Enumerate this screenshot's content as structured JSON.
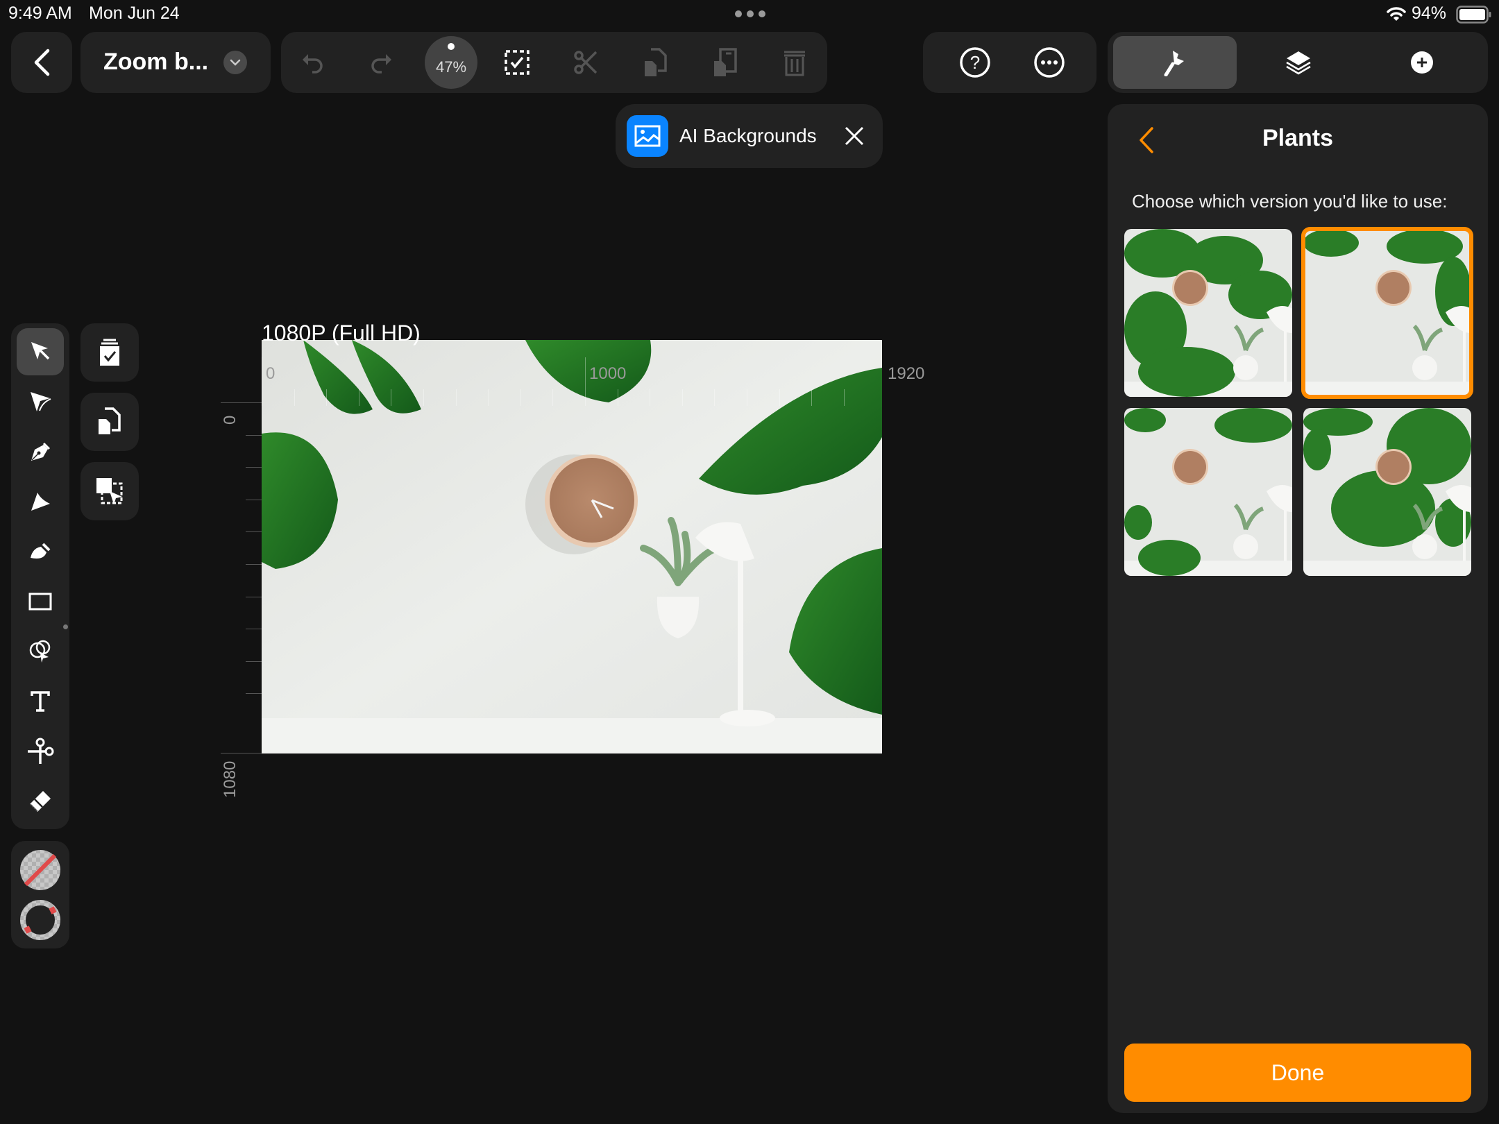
{
  "status_bar": {
    "time": "9:49 AM",
    "date": "Mon Jun 24",
    "battery": "94%",
    "icons": [
      "multitask-dots-icon",
      "wifi-icon",
      "battery-icon"
    ]
  },
  "header": {
    "back_icon": "chevron-left-icon",
    "document_title": "Zoom b...",
    "title_dropdown_icon": "chevron-down-icon",
    "zoom_level": "47%",
    "toolbar_icons": [
      "undo-icon",
      "redo-icon",
      "zoom-indicator",
      "select-all-icon",
      "cut-icon",
      "copy-icon",
      "paste-icon",
      "delete-icon"
    ],
    "help_icon": "question-circle-icon",
    "more_icon": "ellipsis-circle-icon",
    "tabs": [
      {
        "name": "style",
        "icon": "brush-icon",
        "active": true
      },
      {
        "name": "layers",
        "icon": "layers-icon",
        "active": false
      },
      {
        "name": "add",
        "icon": "plus-circle-icon",
        "active": false
      }
    ]
  },
  "ai_chip": {
    "icon": "image-icon",
    "label": "AI Backgrounds",
    "close_icon": "close-icon"
  },
  "tools": {
    "items": [
      {
        "name": "selection-tool",
        "icon": "arrow-select-icon",
        "active": true
      },
      {
        "name": "node-tool",
        "icon": "node-select-icon",
        "active": false
      },
      {
        "name": "pen-tool",
        "icon": "pen-nib-icon",
        "active": false
      },
      {
        "name": "pencil-tool",
        "icon": "pencil-icon",
        "active": false
      },
      {
        "name": "brush-tool",
        "icon": "brush-icon",
        "active": false
      },
      {
        "name": "shape-tool",
        "icon": "rectangle-icon",
        "active": false
      },
      {
        "name": "fill-tool",
        "icon": "fill-select-icon",
        "active": false
      },
      {
        "name": "text-tool",
        "icon": "text-icon",
        "active": false
      },
      {
        "name": "scissors-tool",
        "icon": "scissors-icon",
        "active": false
      },
      {
        "name": "eraser-tool",
        "icon": "eraser-icon",
        "active": false
      }
    ],
    "side_actions": [
      {
        "name": "paste-checkbox",
        "icon": "clipboard-check-icon"
      },
      {
        "name": "duplicate",
        "icon": "duplicate-icon"
      },
      {
        "name": "transform-selection",
        "icon": "select-transform-icon"
      }
    ],
    "fill_color": "none",
    "stroke_color": "none"
  },
  "canvas": {
    "preset_label": "1080P (Full HD)",
    "ruler_x": [
      "0",
      "1000",
      "1920"
    ],
    "ruler_y": [
      "0",
      "1080"
    ]
  },
  "panel": {
    "back_icon": "chevron-left-icon",
    "title": "Plants",
    "prompt": "Choose which version you'd like to use:",
    "options": [
      {
        "name": "version-1",
        "selected": false
      },
      {
        "name": "version-2",
        "selected": true
      },
      {
        "name": "version-3",
        "selected": false
      },
      {
        "name": "version-4",
        "selected": false
      }
    ],
    "done_label": "Done",
    "accent": "#FF8C00"
  },
  "colors": {
    "background": "#121212",
    "surface": "#222222",
    "accent": "#FF8C00",
    "ai_icon_blue": "#0A84FF"
  }
}
